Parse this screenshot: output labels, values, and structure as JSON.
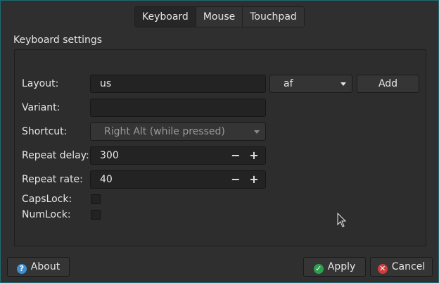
{
  "tabs": [
    {
      "label": "Keyboard",
      "active": true
    },
    {
      "label": "Mouse",
      "active": false
    },
    {
      "label": "Touchpad",
      "active": false
    }
  ],
  "group": {
    "title": "Keyboard settings"
  },
  "layout": {
    "label": "Layout:",
    "value": "us",
    "variant_option": "af",
    "add_label": "Add"
  },
  "variant": {
    "label": "Variant:",
    "value": ""
  },
  "shortcut": {
    "label": "Shortcut:",
    "value": "Right Alt (while pressed)"
  },
  "repeat_delay": {
    "label": "Repeat delay:",
    "value": "300"
  },
  "repeat_rate": {
    "label": "Repeat rate:",
    "value": "40"
  },
  "capslock": {
    "label": "CapsLock:",
    "checked": false
  },
  "numlock": {
    "label": "NumLock:",
    "checked": false
  },
  "buttons": {
    "about": "About",
    "apply": "Apply",
    "cancel": "Cancel"
  },
  "icons": {
    "about": "help-icon",
    "apply": "check-icon",
    "cancel": "close-icon",
    "spin_minus": "minus-icon",
    "spin_plus": "plus-icon"
  },
  "colors": {
    "accent_border": "#1c6b73",
    "apply_green": "#2e9e4f",
    "cancel_red": "#d23b3b",
    "about_blue": "#3d8fd1"
  }
}
